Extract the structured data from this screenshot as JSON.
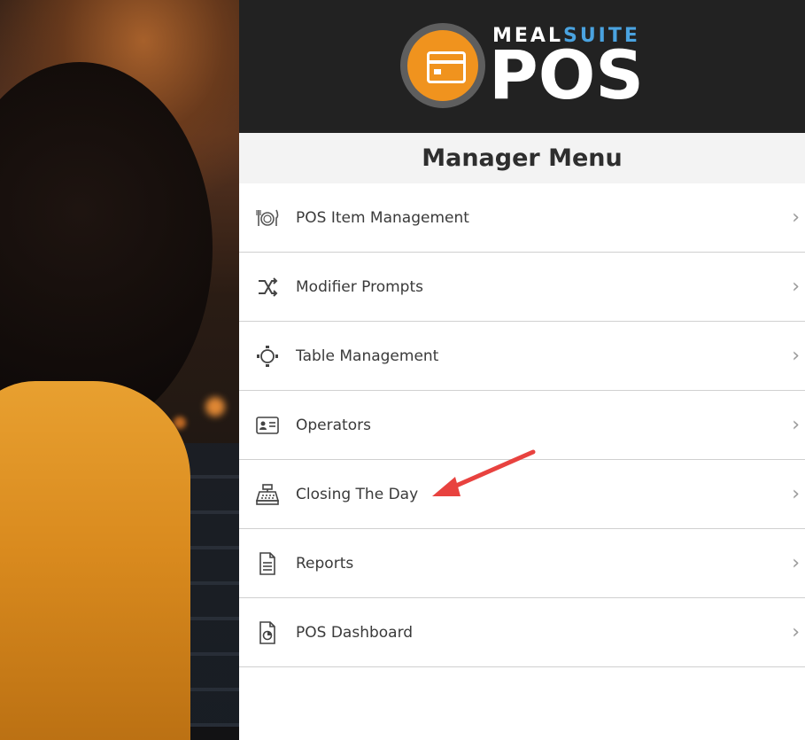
{
  "brand": {
    "meal": "MEAL",
    "suite": "SUITE",
    "pos": "POS",
    "icon": "credit-card-icon",
    "colors": {
      "orange": "#f0931e",
      "blue": "#4aa3e0",
      "header": "#222222"
    }
  },
  "menu": {
    "title": "Manager Menu",
    "items": [
      {
        "label": "POS Item Management",
        "icon": "utensils-plate-icon"
      },
      {
        "label": "Modifier Prompts",
        "icon": "shuffle-icon"
      },
      {
        "label": "Table Management",
        "icon": "table-chairs-icon"
      },
      {
        "label": "Operators",
        "icon": "id-card-icon"
      },
      {
        "label": "Closing The Day",
        "icon": "cash-register-icon"
      },
      {
        "label": "Reports",
        "icon": "document-icon"
      },
      {
        "label": "POS Dashboard",
        "icon": "dashboard-chart-icon"
      }
    ],
    "chevron": "›"
  },
  "annotation": {
    "type": "arrow",
    "target": "Closing The Day",
    "color": "#e8423f"
  }
}
